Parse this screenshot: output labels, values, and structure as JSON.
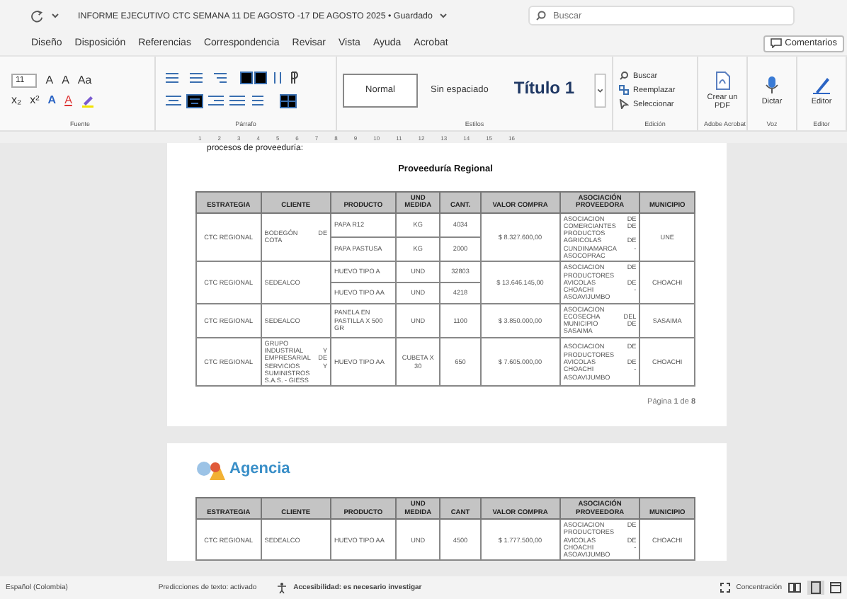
{
  "window": {
    "title": "INFORME EJECUTIVO CTC SEMANA 11 DE AGOSTO -17 DE AGOSTO 2025 • Guardado"
  },
  "search": {
    "placeholder": "Buscar"
  },
  "menu": [
    "Diseño",
    "Disposición",
    "Referencias",
    "Correspondencia",
    "Revisar",
    "Vista",
    "Ayuda",
    "Acrobat"
  ],
  "comments_button": "Comentarios",
  "ribbon": {
    "font": {
      "label": "Fuente",
      "size": "11",
      "row1": [
        "A",
        "A",
        "Aa"
      ],
      "row2": [
        "x₂",
        "x²",
        "A",
        "A"
      ]
    },
    "paragraph": {
      "label": "Párrafo"
    },
    "styles": {
      "label": "Estilos",
      "items": [
        {
          "label": "Normal",
          "kind": "body",
          "selected": true
        },
        {
          "label": "Sin espaciado",
          "kind": "body",
          "selected": false
        },
        {
          "label": "Título 1",
          "kind": "heading",
          "selected": false
        }
      ]
    },
    "editing": {
      "label": "Edición",
      "items": [
        {
          "label": "Buscar",
          "kind": "search"
        },
        {
          "label": "Reemplazar",
          "kind": "replace"
        },
        {
          "label": "Seleccionar",
          "kind": "select"
        }
      ]
    },
    "tools": [
      {
        "label": "Crear un PDF",
        "group": "Adobe Acrobat",
        "kind": "pdf"
      },
      {
        "label": "Dictar",
        "group": "Voz",
        "kind": "mic"
      },
      {
        "label": "Editor",
        "group": "Editor",
        "kind": "pen"
      }
    ]
  },
  "ruler": [
    "1",
    "2",
    "3",
    "4",
    "5",
    "6",
    "7",
    "8",
    "9",
    "10",
    "11",
    "12",
    "13",
    "14",
    "15",
    "16"
  ],
  "page1": {
    "intro": "procesos de proveeduría:",
    "heading": "Proveeduría Regional",
    "columns": [
      "ESTRATEGIA",
      "CLIENTE",
      "PRODUCTO",
      "UND MEDIDA",
      "CANT.",
      "VALOR COMPRA",
      "ASOCIACIÓN PROVEEDORA",
      "MUNICIPIO"
    ],
    "groups": [
      {
        "estrategia": "CTC REGIONAL",
        "cliente": "BODEGÓN DE COTA",
        "items": [
          {
            "producto": "PAPA R12",
            "und": "KG",
            "cant": "4034"
          },
          {
            "producto": "PAPA PASTUSA",
            "und": "KG",
            "cant": "2000"
          }
        ],
        "valor": "$ 8.327.600,00",
        "asociacion": "ASOCIACION DE COMERCIANTES DE PRODUCTOS AGRICOLAS DE CUNDINAMARCA - ASOCOPRAC",
        "municipio": "UNE"
      },
      {
        "estrategia": "CTC REGIONAL",
        "cliente": "SEDEALCO",
        "items": [
          {
            "producto": "HUEVO TIPO A",
            "und": "UND",
            "cant": "32803"
          },
          {
            "producto": "HUEVO TIPO AA",
            "und": "UND",
            "cant": "4218"
          }
        ],
        "valor": "$ 13.646.145,00",
        "asociacion": "ASOCIACION DE PRODUCTORES AVICOLAS DE CHOACHI - ASOAVIJUMBO",
        "municipio": "CHOACHI"
      },
      {
        "estrategia": "CTC REGIONAL",
        "cliente": "SEDEALCO",
        "items": [
          {
            "producto": "PANELA EN PASTILLA X 500 GR",
            "und": "UND",
            "cant": "1100"
          }
        ],
        "valor": "$ 3.850.000,00",
        "asociacion": "ASOCIACION ECOSECHA DEL MUNICIPIO DE SASAIMA",
        "municipio": "SASAIMA"
      },
      {
        "estrategia": "CTC REGIONAL",
        "cliente": "GRUPO INDUSTRIAL Y EMPRESARIAL DE SERVICIOS Y SUMINISTROS S.A.S. - GIESS",
        "items": [
          {
            "producto": "HUEVO TIPO AA",
            "und": "CUBETA X 30",
            "cant": "650"
          }
        ],
        "valor": "$ 7.605.000,00",
        "asociacion": "ASOCIACION DE PRODUCTORES AVICOLAS DE CHOACHI - ASOAVIJUMBO",
        "municipio": "CHOACHI"
      }
    ],
    "footer": "Página **1** de **8**"
  },
  "page2": {
    "logo": "Agencia",
    "columns": [
      "ESTRATEGIA",
      "CLIENTE",
      "PRODUCTO",
      "UND MEDIDA",
      "CANT",
      "VALOR COMPRA",
      "ASOCIACIÓN PROVEEDORA",
      "MUNICIPIO"
    ],
    "groups": [
      {
        "estrategia": "CTC REGIONAL",
        "cliente": "SEDEALCO",
        "items": [
          {
            "producto": "HUEVO TIPO AA",
            "und": "UND",
            "cant": "4500"
          }
        ],
        "valor": "$ 1.777.500,00",
        "asociacion": "ASOCIACION DE PRODUCTORES AVICOLAS DE CHOACHI - ASOAVIJUMBO",
        "municipio": "CHOACHI"
      }
    ]
  },
  "status_bar": {
    "language": "Español (Colombia)",
    "predictions": "Predicciones de texto: activado",
    "accessibility": "Accesibilidad: es necesario investigar",
    "focus": "Concentración"
  }
}
